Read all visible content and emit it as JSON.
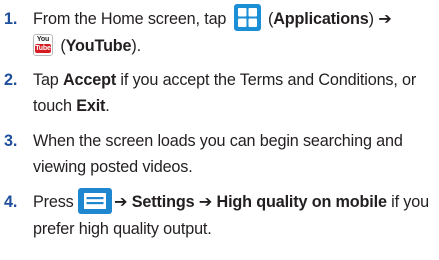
{
  "steps": [
    {
      "number": "1.",
      "t1": "From the Home screen, tap",
      "applications": "Applications",
      "arrow": "➔",
      "youtube": "YouTube",
      "close": ")."
    },
    {
      "number": "2.",
      "t1": "Tap ",
      "accept": "Accept",
      "t2": " if you accept the Terms and Conditions, or touch ",
      "exit": "Exit",
      "t3": "."
    },
    {
      "number": "3.",
      "text": "When the screen loads you can begin searching and viewing posted videos."
    },
    {
      "number": "4.",
      "press": "Press",
      "path": "➔ Settings ➔ High quality on mobile",
      "t2": " if you prefer high quality output."
    }
  ],
  "icons": {
    "youtube_you": "You",
    "youtube_tube": "Tube",
    "applications_color": "#1a8fd6",
    "menu_color": "#1f86d0"
  }
}
